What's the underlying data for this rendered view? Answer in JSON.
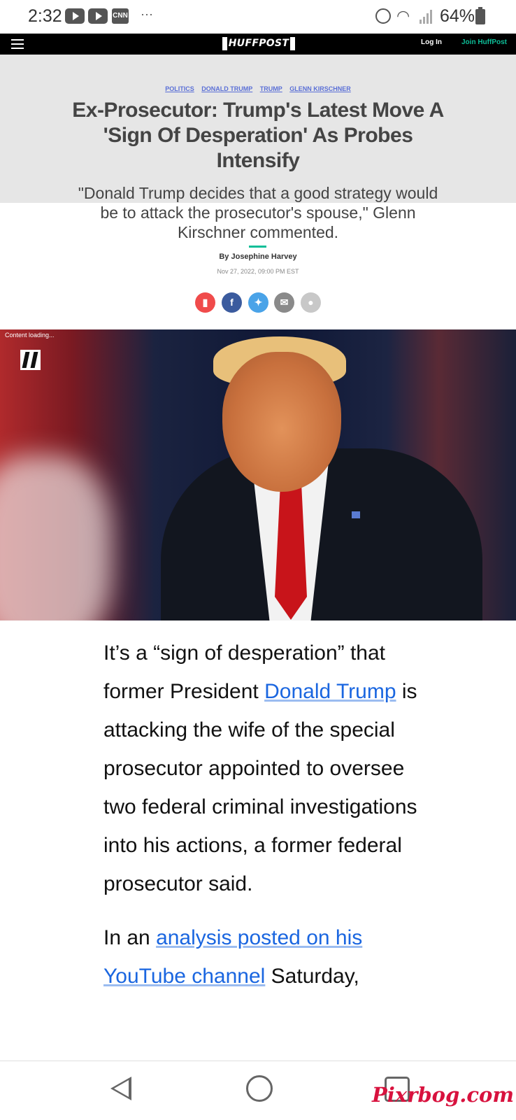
{
  "status_bar": {
    "time": "2:32",
    "battery": "64%",
    "notif_cnn": "CNN",
    "more": "···"
  },
  "header": {
    "logo": "HUFFPOST",
    "login": "Log In",
    "join": "Join HuffPost"
  },
  "article": {
    "tags": [
      "POLITICS",
      "DONALD TRUMP",
      "TRUMP",
      "GLENN KIRSCHNER"
    ],
    "headline": "Ex-Prosecutor: Trump's Latest Move A 'Sign Of Desperation' As Probes Intensify",
    "subhead": "\"Donald Trump decides that a good strategy would be to attack the prosecutor's spouse,\" Glenn Kirschner commented.",
    "byline": "By Josephine Harvey",
    "date": "Nov 27, 2022, 09:00 PM EST",
    "video_status": "Content loading...",
    "p1_before": "It’s a “sign of desperation” that former President ",
    "p1_link": "Donald Trump",
    "p1_after": " is attacking the wife of the special prosecutor appointed to oversee two federal criminal investigations into his actions, a former federal prosecutor said.",
    "p2_before": "In an ",
    "p2_link": "analysis posted on his YouTube channel",
    "p2_after": " Saturday,"
  },
  "share_icons": [
    "bookmark-icon",
    "facebook-icon",
    "twitter-icon",
    "email-icon",
    "comment-icon"
  ],
  "colors": {
    "accent": "#0dbe98",
    "link": "#1a66e0",
    "tag": "#5a6fd6"
  },
  "watermark": "Pixrbog.com"
}
